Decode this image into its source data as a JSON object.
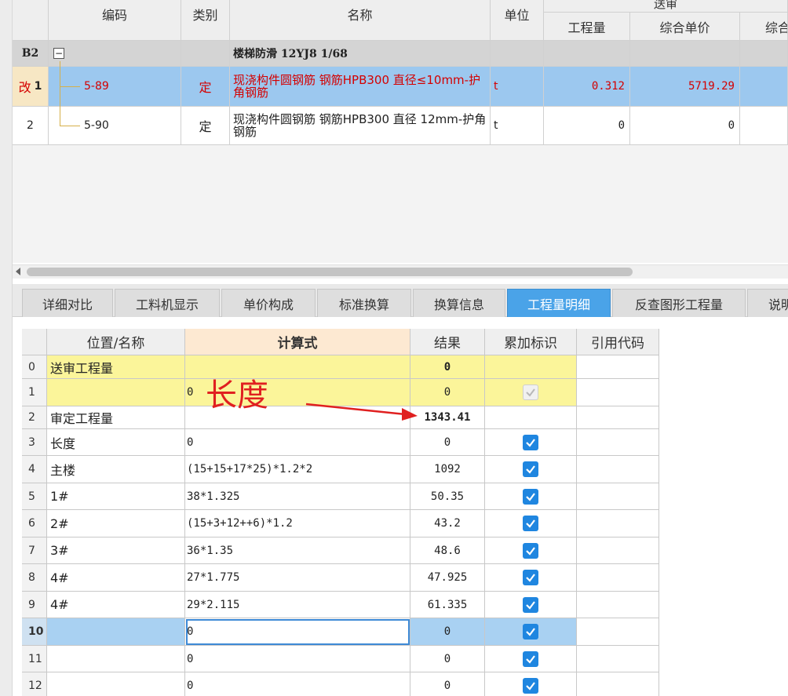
{
  "top_table": {
    "headers": {
      "code": "编码",
      "type": "类别",
      "name": "名称",
      "unit": "单位",
      "group": "送审",
      "quantity": "工程量",
      "unit_price": "综合单价",
      "total": "综合"
    },
    "rows": [
      {
        "num": "B2",
        "code": "",
        "type": "",
        "name": "楼梯防滑 12YJ8 1/68",
        "unit": "",
        "quantity": "",
        "unit_price": ""
      },
      {
        "flag": "改",
        "num": "1",
        "code": "5-89",
        "type": "定",
        "name": "现浇构件圆钢筋 钢筋HPB300 直径≤10mm-护角钢筋",
        "unit": "t",
        "quantity": "0.312",
        "unit_price": "5719.29"
      },
      {
        "num": "2",
        "code": "5-90",
        "type": "定",
        "name": "现浇构件圆钢筋 钢筋HPB300 直径 12mm-护角钢筋",
        "unit": "t",
        "quantity": "0",
        "unit_price": "0"
      }
    ],
    "expander_glyph": "−"
  },
  "tabs": [
    {
      "label": "详细对比",
      "active": false
    },
    {
      "label": "工料机显示",
      "active": false
    },
    {
      "label": "单价构成",
      "active": false
    },
    {
      "label": "标准换算",
      "active": false
    },
    {
      "label": "换算信息",
      "active": false
    },
    {
      "label": "工程量明细",
      "active": true
    },
    {
      "label": "反查图形工程量",
      "active": false
    },
    {
      "label": "说明",
      "active": false
    }
  ],
  "detail_table": {
    "headers": {
      "position_name": "位置/名称",
      "formula": "计算式",
      "result": "结果",
      "accumulate": "累加标识",
      "ref_code": "引用代码"
    },
    "rows": [
      {
        "num": "0",
        "name": "送审工程量",
        "formula": "",
        "result": "0",
        "check": "none",
        "ref": ""
      },
      {
        "num": "1",
        "name": "",
        "formula": "0",
        "result": "0",
        "check": "disabled",
        "ref": ""
      },
      {
        "num": "2",
        "name": "审定工程量",
        "formula": "",
        "result": "1343.41",
        "check": "none",
        "ref": ""
      },
      {
        "num": "3",
        "name": "长度",
        "formula": "0",
        "result": "0",
        "check": "checked",
        "ref": ""
      },
      {
        "num": "4",
        "name": "主楼",
        "formula": "(15+15+17*25)*1.2*2",
        "result": "1092",
        "check": "checked",
        "ref": ""
      },
      {
        "num": "5",
        "name": "1#",
        "formula": "38*1.325",
        "result": "50.35",
        "check": "checked",
        "ref": ""
      },
      {
        "num": "6",
        "name": "2#",
        "formula": "(15+3+12++6)*1.2",
        "result": "43.2",
        "check": "checked",
        "ref": ""
      },
      {
        "num": "7",
        "name": "3#",
        "formula": "36*1.35",
        "result": "48.6",
        "check": "checked",
        "ref": ""
      },
      {
        "num": "8",
        "name": "4#",
        "formula": "27*1.775",
        "result": "47.925",
        "check": "checked",
        "ref": ""
      },
      {
        "num": "9",
        "name": "4#",
        "formula": "29*2.115",
        "result": "61.335",
        "check": "checked",
        "ref": ""
      },
      {
        "num": "10",
        "name": "",
        "formula": "0",
        "result": "0",
        "check": "checked",
        "ref": ""
      },
      {
        "num": "11",
        "name": "",
        "formula": "0",
        "result": "0",
        "check": "checked",
        "ref": ""
      },
      {
        "num": "12",
        "name": "",
        "formula": "0",
        "result": "0",
        "check": "checked",
        "ref": ""
      }
    ]
  },
  "annotation": {
    "text": "长度",
    "color": "#e02020"
  },
  "colors": {
    "selected_row": "#9cc8ef",
    "active_tab": "#4aa3e8",
    "yellow_row": "#fbf59a",
    "checkbox": "#1f86e0",
    "modified_text": "#d40000"
  }
}
